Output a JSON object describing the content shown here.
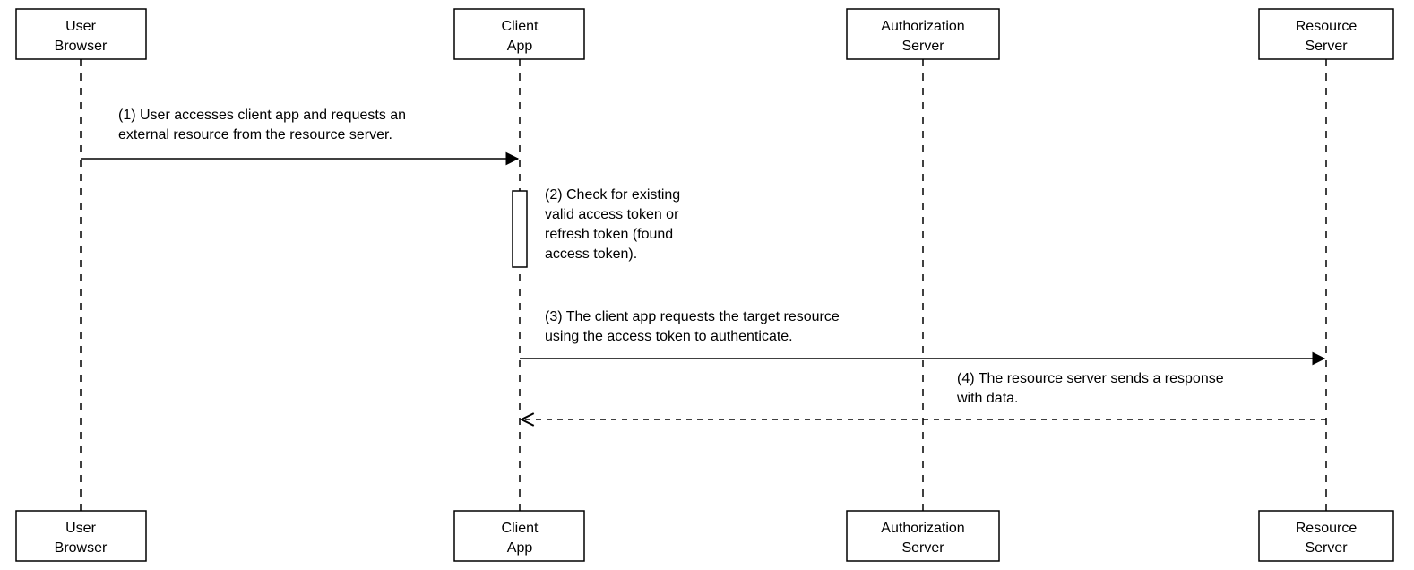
{
  "participants": [
    {
      "id": "user",
      "line1": "User",
      "line2": "Browser"
    },
    {
      "id": "client",
      "line1": "Client",
      "line2": "App"
    },
    {
      "id": "authz",
      "line1": "Authorization",
      "line2": "Server"
    },
    {
      "id": "res",
      "line1": "Resource",
      "line2": "Server"
    }
  ],
  "messages": {
    "m1": {
      "line1": "(1) User accesses client app and requests an",
      "line2": "external resource from the resource server."
    },
    "m2": {
      "line1": "(2) Check for existing",
      "line2": "valid access token or",
      "line3": "refresh token (found",
      "line4": "access token)."
    },
    "m3": {
      "line1": "(3) The client app requests the target resource",
      "line2": "using the access token to authenticate."
    },
    "m4": {
      "line1": "(4) The resource server sends a response",
      "line2": "with data."
    }
  }
}
